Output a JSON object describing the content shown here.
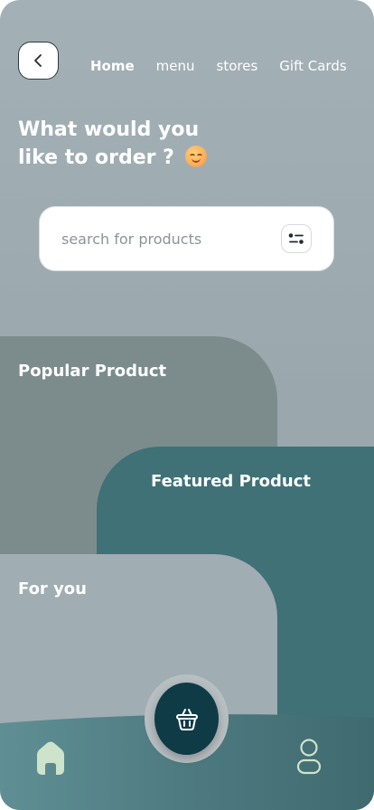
{
  "header": {
    "back_icon": "chevron-left-icon",
    "nav": [
      {
        "label": "Home",
        "active": true
      },
      {
        "label": "menu",
        "active": false
      },
      {
        "label": "stores",
        "active": false
      },
      {
        "label": "Gift Cards",
        "active": false
      }
    ]
  },
  "headline": {
    "line1": "What would you",
    "line2": "like to order ?",
    "emoji": "smiling-face-emoji"
  },
  "search": {
    "placeholder": "search for products",
    "value": "",
    "filter_icon": "filter-icon"
  },
  "cards": {
    "popular": {
      "title": "Popular Product",
      "color": "#7c8c8d"
    },
    "featured": {
      "title": "Featured Product",
      "color": "#3f7176"
    },
    "foryou": {
      "title": "For you",
      "color": "#a0adb2"
    }
  },
  "bottom_nav": {
    "home_icon": "home-icon",
    "basket_icon": "basket-icon",
    "profile_icon": "user-icon",
    "accent": "#cde3cc",
    "fab_color": "#0f3b47"
  }
}
